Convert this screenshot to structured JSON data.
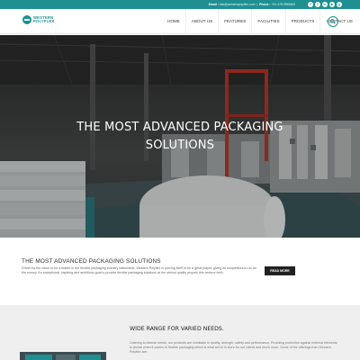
{
  "topbar": {
    "email_label": "Email :",
    "email": "info@westernpolyflex.com",
    "phone_label": "Phone :",
    "phone": "+91 478 2553500",
    "social": [
      {
        "icon": "facebook-icon",
        "glyph": "f"
      },
      {
        "icon": "twitter-icon",
        "glyph": "t"
      },
      {
        "icon": "linkedin-icon",
        "glyph": "in"
      },
      {
        "icon": "youtube-icon",
        "glyph": "▶"
      },
      {
        "icon": "google-plus-icon",
        "glyph": "g"
      }
    ]
  },
  "header": {
    "logo_line1": "WESTERN",
    "logo_line2": "POLYFLEX",
    "nav": [
      "HOME",
      "ABOUT US",
      "FEATURES",
      "FACILITIES",
      "PRODUCTS",
      "CONTACT US"
    ]
  },
  "hero": {
    "title": "THE MOST ADVANCED PACKAGING SOLUTIONS"
  },
  "intro": {
    "title": "THE MOST ADVANCED PACKAGING SOLUTIONS",
    "text": "Driven by the vision to be a leader in the flexible packaging industry nationwide, Western Polyflex is proving itself to be a great player, giving its competitors a run for the money. An exceptional, inspiring and ambitious goal to provide flexible packaging solutions at the utmost quality propels this venture forth.",
    "button": "READ MORE"
  },
  "range": {
    "title": "WIDE RANGE FOR VARIED NEEDS.",
    "text": "Catering to diverse needs, our products are inimitable in quality, strength, safety and performance. Providing protection against external elements is pivotal when it comes to flexible packaging which is what we've in store for our clients and much more. Some of the offerings from Western Polyflex are:"
  },
  "colors": {
    "brand": "#1f8f92",
    "dark": "#222222",
    "hero_frame": "#c0392b"
  }
}
